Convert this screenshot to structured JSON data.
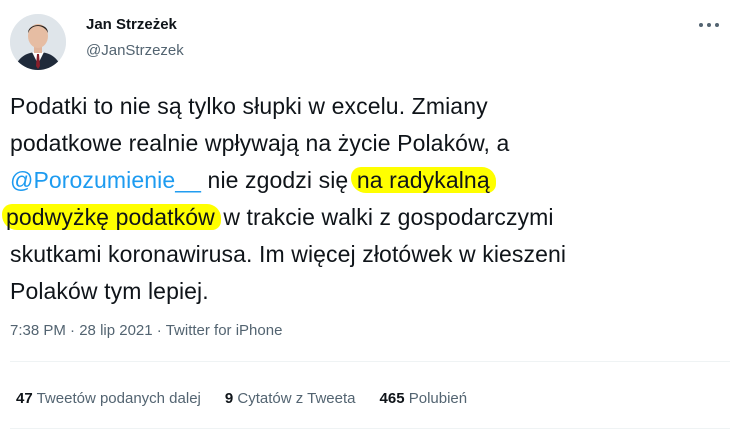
{
  "author": {
    "name": "Jan Strzeżek",
    "handle": "@JanStrzezek"
  },
  "tweet": {
    "line1": "Podatki to nie są tylko słupki w excelu. Zmiany",
    "line2": "podatkowe realnie wpływają na życie Polaków, a",
    "mention": "@Porozumienie__",
    "line3_mid": " nie zgodzi się ",
    "highlight1": "na radykalną",
    "highlight2": "podwyżkę podatków",
    "line4_rest": " w trakcie walki z gospodarczymi",
    "line5": "skutkami koronawirusa. Im więcej złotówek w kieszeni",
    "line6": "Polaków tym lepiej."
  },
  "meta": {
    "time": "7:38 PM",
    "date": "28 lip 2021",
    "source": "Twitter for iPhone",
    "separator": " · "
  },
  "stats": {
    "retweets_count": "47",
    "retweets_label": "Tweetów podanych dalej",
    "quotes_count": "9",
    "quotes_label": "Cytatów z Tweeta",
    "likes_count": "465",
    "likes_label": "Polubień"
  },
  "colors": {
    "link": "#1d9bf0",
    "highlight": "#ffff00",
    "secondary_text": "#536471"
  },
  "icons": {
    "more": "more-dots-icon"
  }
}
